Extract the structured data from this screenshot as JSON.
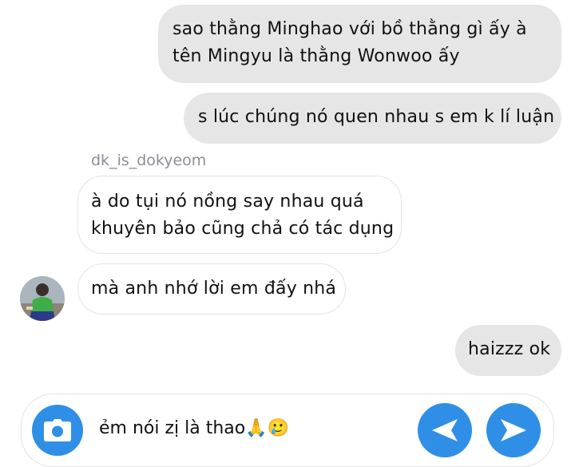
{
  "messages": [
    {
      "lines": [
        "sao thằng Minghao với bồ thằng gì ấy à",
        "tên Mingyu là thằng Wonwoo ấy"
      ]
    },
    {
      "lines": [
        "s lúc chúng nó quen nhau s em k lí luận"
      ]
    },
    {
      "lines": [
        "à do tụi nó nồng say nhau quá",
        "khuyên bảo cũng chả có tác dụng"
      ]
    },
    {
      "lines": [
        "mà anh nhớ lời em đấy nhá"
      ]
    },
    {
      "lines": [
        "haizzz ok"
      ]
    }
  ],
  "sender_name": "dk_is_dokyeom",
  "composer": {
    "text": "ẻm nói zị là thao🙏🥲"
  },
  "colors": {
    "accent": "#2f8fe6",
    "outgoing_bubble": "#e6e6e6",
    "incoming_border": "#e4e4e4"
  },
  "icons": {
    "camera": "camera-icon",
    "back": "arrow-left-icon",
    "send": "send-icon"
  }
}
